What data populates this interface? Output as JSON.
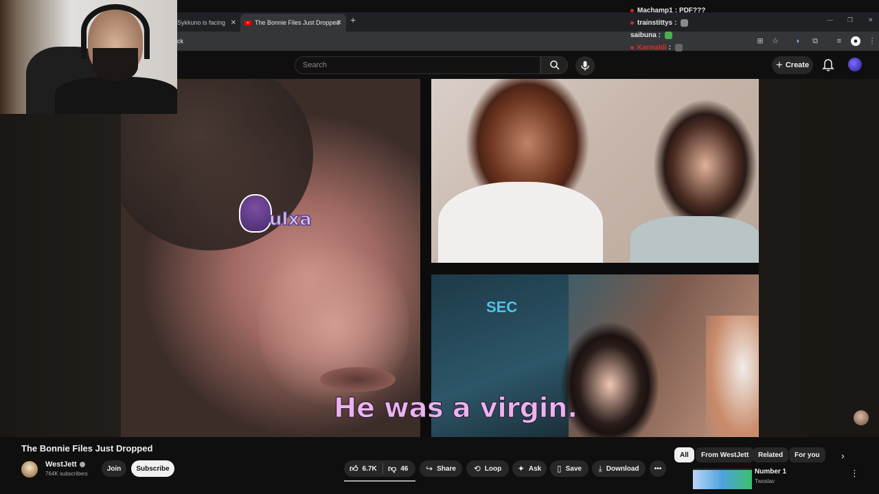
{
  "browser": {
    "tabs": [
      {
        "label": "Sykkuno is facing"
      },
      {
        "label": "The Bonnie Files Just Dropped"
      }
    ],
    "address_fragment": "ck"
  },
  "chat": [
    {
      "user": "Machamp1",
      "text": "PDF???",
      "color": "#e8e8e8"
    },
    {
      "user": "trainstittys",
      "text": "",
      "color": "#e8e8e8"
    },
    {
      "user": "saibuna",
      "text": "",
      "color": "#e8e8e8"
    },
    {
      "user": "Karmaldi",
      "text": "",
      "color": "#d93025"
    }
  ],
  "header": {
    "search_placeholder": "Search",
    "create_label": "Create"
  },
  "video": {
    "subtitle": "He was a virgin.",
    "sticker_text": "ulxa",
    "overlay_logo": "SEC"
  },
  "below": {
    "title": "The Bonnie Files Just Dropped",
    "channel": "WestJett",
    "subscribers": "764K subscribers",
    "join_label": "Join",
    "subscribe_label": "Subscribe",
    "likes": "6.7K",
    "dislikes": "46",
    "share_label": "Share",
    "loop_label": "Loop",
    "ask_label": "Ask",
    "save_label": "Save",
    "download_label": "Download"
  },
  "sidebar": {
    "chips": [
      "All",
      "From WestJett",
      "Related",
      "For you"
    ],
    "recommendation": {
      "title": "Number 1",
      "channel": "Twoslav"
    }
  },
  "colors": {
    "background": "#0f0f0f",
    "subtitle": "#e9b4ee",
    "accent_red": "#ff0000"
  }
}
